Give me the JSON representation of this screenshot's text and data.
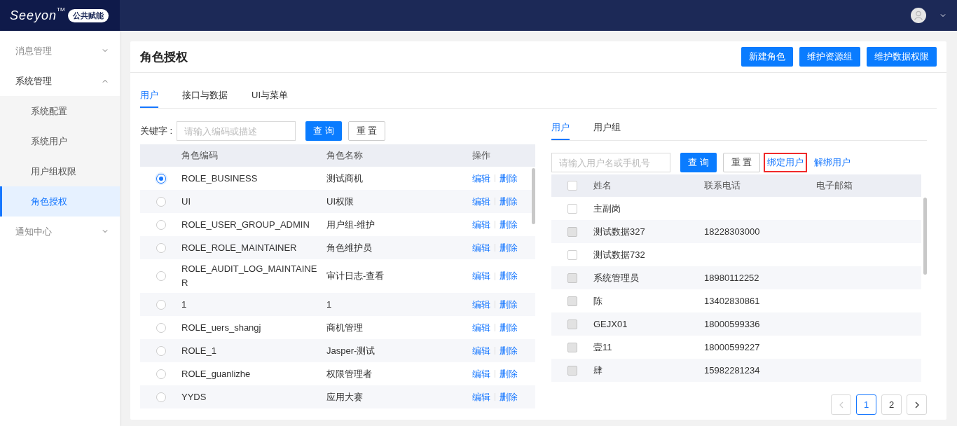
{
  "header": {
    "logo": "Seeyon",
    "logo_mark": "TM",
    "badge": "公共赋能"
  },
  "sidebar": {
    "items": [
      {
        "label": "消息管理",
        "expanded": false,
        "selected": false
      },
      {
        "label": "系统管理",
        "expanded": true,
        "selected": false,
        "children": [
          {
            "label": "系统配置",
            "selected": false
          },
          {
            "label": "系统用户",
            "selected": false
          },
          {
            "label": "用户组权限",
            "selected": false
          },
          {
            "label": "角色授权",
            "selected": true
          }
        ]
      },
      {
        "label": "通知中心",
        "expanded": false,
        "selected": false
      }
    ]
  },
  "page": {
    "title": "角色授权",
    "buttons": [
      "新建角色",
      "维护资源组",
      "维护数据权限"
    ],
    "tabs": [
      {
        "label": "用户",
        "selected": true
      },
      {
        "label": "接口与数据",
        "selected": false
      },
      {
        "label": "UI与菜单",
        "selected": false
      }
    ]
  },
  "roles": {
    "keyword_label": "关键字 :",
    "search": {
      "placeholder": "请输入编码或描述"
    },
    "query_button": "查 询",
    "reset_button": "重 置",
    "columns": [
      "角色编码",
      "角色名称",
      "操作"
    ],
    "rows": [
      {
        "code": "ROLE_BUSINESS",
        "name": "测试商机",
        "edit": "编辑",
        "delete": "删除",
        "selected": true
      },
      {
        "code": "UI",
        "name": "UI权限",
        "edit": "编辑",
        "delete": "删除",
        "selected": false
      },
      {
        "code": "ROLE_USER_GROUP_ADMIN",
        "name": "用户组-维护",
        "edit": "编辑",
        "delete": "删除",
        "selected": false
      },
      {
        "code": "ROLE_ROLE_MAINTAINER",
        "name": "角色维护员",
        "edit": "编辑",
        "delete": "删除",
        "selected": false
      },
      {
        "code": "ROLE_AUDIT_LOG_MAINTAINER",
        "name": "审计日志-查看",
        "edit": "编辑",
        "delete": "删除",
        "selected": false
      },
      {
        "code": "1",
        "name": "1",
        "edit": "编辑",
        "delete": "删除",
        "selected": false
      },
      {
        "code": "ROLE_uers_shangj",
        "name": "商机管理",
        "edit": "编辑",
        "delete": "删除",
        "selected": false
      },
      {
        "code": "ROLE_1",
        "name": "Jasper-测试",
        "edit": "编辑",
        "delete": "删除",
        "selected": false
      },
      {
        "code": "ROLE_guanlizhe",
        "name": "权限管理者",
        "edit": "编辑",
        "delete": "删除",
        "selected": false
      },
      {
        "code": "YYDS",
        "name": "应用大赛",
        "edit": "编辑",
        "delete": "删除",
        "selected": false
      }
    ]
  },
  "users": {
    "tabs": [
      {
        "label": "用户",
        "selected": true
      },
      {
        "label": "用户组",
        "selected": false
      }
    ],
    "search": {
      "placeholder": "请输入用户名或手机号"
    },
    "query_button": "查 询",
    "reset_button": "重 置",
    "links": [
      {
        "label": "绑定用户",
        "highlighted": true
      },
      {
        "label": "解绑用户",
        "highlighted": false
      }
    ],
    "columns": [
      "姓名",
      "联系电话",
      "电子邮箱"
    ],
    "header_checkbox": {
      "checked": false,
      "disabled": false
    },
    "rows": [
      {
        "name": "主副岗",
        "checked": false,
        "disabled": false
      },
      {
        "name": "测试数据327",
        "phone": "18228303000",
        "checked": false,
        "disabled": true
      },
      {
        "name": "测试数据732",
        "checked": false,
        "disabled": false
      },
      {
        "name": "系统管理员",
        "phone": "18980112252",
        "checked": false,
        "disabled": true
      },
      {
        "name": "陈",
        "phone": "13402830861",
        "checked": false,
        "disabled": true
      },
      {
        "name": "GEJX01",
        "phone": "18000599336",
        "checked": false,
        "disabled": true
      },
      {
        "name": "壹11",
        "phone": "18000599227",
        "checked": false,
        "disabled": true
      },
      {
        "name": "肆",
        "phone": "15982281234",
        "checked": false,
        "disabled": true
      }
    ],
    "pagination": {
      "prev_disabled": true,
      "pages": [
        {
          "label": "1",
          "selected": true
        },
        {
          "label": "2",
          "selected": false
        }
      ]
    }
  }
}
